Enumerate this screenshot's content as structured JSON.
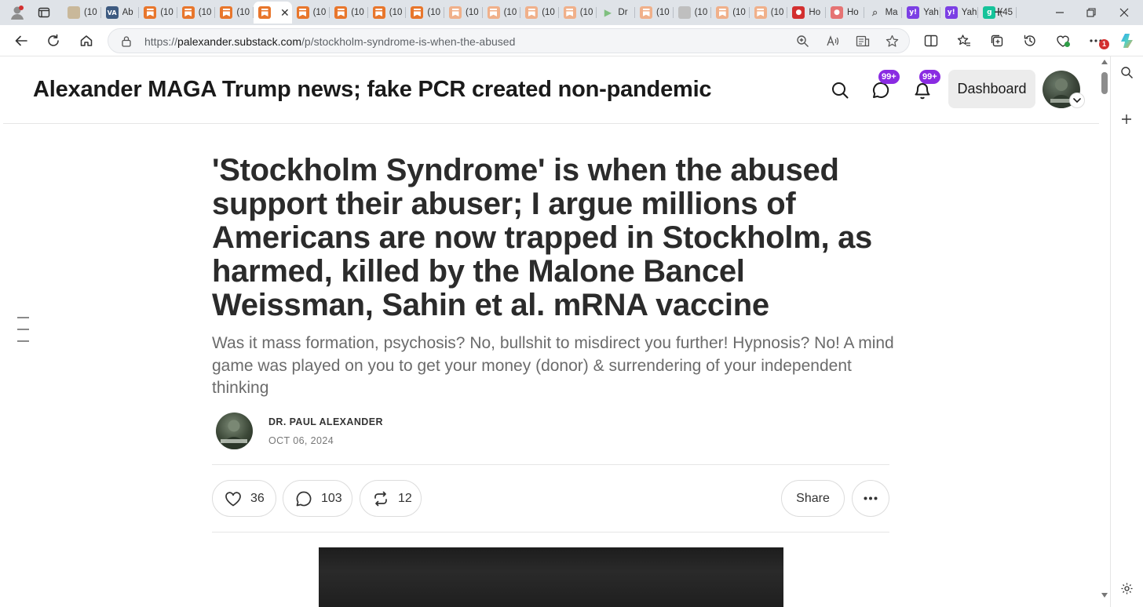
{
  "browser": {
    "tabs": [
      {
        "title": "(10",
        "icon": "image-thumb-icon",
        "color": "#c9b89a"
      },
      {
        "title": "Ab",
        "icon": "va-icon",
        "color": "#3d5a80"
      },
      {
        "title": "(10",
        "icon": "substack-icon",
        "color": "#e8762c"
      },
      {
        "title": "(10",
        "icon": "substack-icon",
        "color": "#e8762c"
      },
      {
        "title": "(10",
        "icon": "substack-icon",
        "color": "#e8762c"
      },
      {
        "title": "",
        "icon": "substack-icon",
        "color": "#e8762c",
        "active": true
      },
      {
        "title": "(10",
        "icon": "substack-icon",
        "color": "#e8762c"
      },
      {
        "title": "(10",
        "icon": "substack-icon",
        "color": "#e8762c"
      },
      {
        "title": "(10",
        "icon": "substack-icon",
        "color": "#e8762c"
      },
      {
        "title": "(10",
        "icon": "substack-icon",
        "color": "#e8762c"
      },
      {
        "title": "(10",
        "icon": "substack-icon-dim",
        "color": "#f0b08a"
      },
      {
        "title": "(10",
        "icon": "substack-icon-dim",
        "color": "#f0b08a"
      },
      {
        "title": "(10",
        "icon": "substack-icon-dim",
        "color": "#f0b08a"
      },
      {
        "title": "(10",
        "icon": "substack-icon-dim",
        "color": "#f0b08a"
      },
      {
        "title": "Dr",
        "icon": "play-icon",
        "color": "#7fbf7f"
      },
      {
        "title": "(10",
        "icon": "substack-icon-dim",
        "color": "#f0b08a"
      },
      {
        "title": "(10",
        "icon": "person-thumb-icon",
        "color": "#bfbfbf"
      },
      {
        "title": "(10",
        "icon": "substack-icon-dim",
        "color": "#f0b08a"
      },
      {
        "title": "(10",
        "icon": "substack-icon-dim",
        "color": "#f0b08a"
      },
      {
        "title": "Ho",
        "icon": "red-app-icon",
        "color": "#d32f2f"
      },
      {
        "title": "Ho",
        "icon": "red-app-icon",
        "color": "#e57373"
      },
      {
        "title": "Ma",
        "icon": "search-icon",
        "color": "#9e9e9e"
      },
      {
        "title": "Yah",
        "icon": "yahoo-icon",
        "color": "#7b3fe4"
      },
      {
        "title": "Yah",
        "icon": "yahoo-icon",
        "color": "#7b3fe4"
      },
      {
        "title": "(45",
        "icon": "grammarly-icon",
        "color": "#15c39a"
      }
    ],
    "active_tab_close": "✕",
    "new_tab": "+",
    "url_prefix": "https://",
    "url_host": "palexander.substack.com",
    "url_path": "/p/stockholm-syndrome-is-when-the-abused",
    "extension_badge": "1"
  },
  "header": {
    "publication_title": "Alexander MAGA Trump news; fake PCR created non-pandemic",
    "chat_badge": "99+",
    "notifications_badge": "99+",
    "dashboard_label": "Dashboard"
  },
  "post": {
    "title": "'Stockholm Syndrome' is when the abused support their abuser; I argue millions of Americans are now trapped in Stockholm, as harmed, killed by the Malone Bancel Weissman, Sahin et al. mRNA vaccine",
    "subtitle": "Was it mass formation, psychosis? No, bullshit to misdirect you further! Hypnosis? No! A mind game was played on you to get your money (donor) & surrendering of your independent thinking",
    "author": "DR. PAUL ALEXANDER",
    "date": "OCT 06, 2024",
    "likes": "36",
    "comments": "103",
    "restacks": "12",
    "share_label": "Share"
  },
  "colors": {
    "accent": "#8a2be2",
    "substack_orange": "#e8762c",
    "tab_strip": "#dfe3e8"
  }
}
